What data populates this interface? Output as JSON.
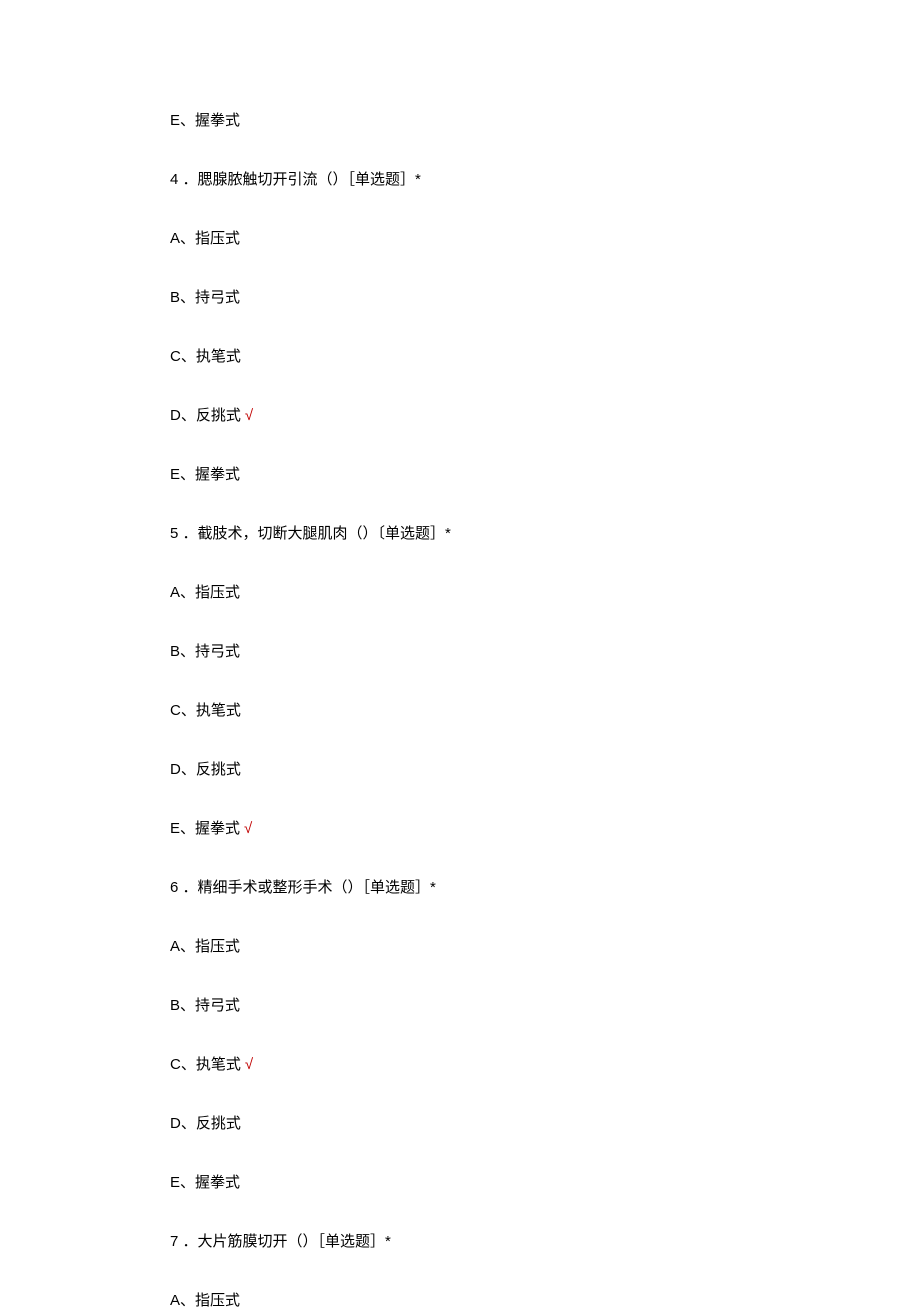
{
  "lines": [
    {
      "text": "E、握拳式",
      "check": false
    },
    {
      "text": "4 ．腮腺脓触切开引流（）［单选题］*",
      "check": false
    },
    {
      "text": "A、指压式",
      "check": false
    },
    {
      "text": "B、持弓式",
      "check": false
    },
    {
      "text": "C、执笔式",
      "check": false
    },
    {
      "text": "D、反挑式",
      "check": true
    },
    {
      "text": "E、握拳式",
      "check": false
    },
    {
      "text": "5 ．截肢术，切断大腿肌肉（）〔单选题］*",
      "check": false
    },
    {
      "text": "A、指压式",
      "check": false
    },
    {
      "text": "B、持弓式",
      "check": false
    },
    {
      "text": "C、执笔式",
      "check": false
    },
    {
      "text": "D、反挑式",
      "check": false
    },
    {
      "text": "E、握拳式",
      "check": true
    },
    {
      "text": "6 ．精细手术或整形手术（）［单选题］*",
      "check": false
    },
    {
      "text": "A、指压式",
      "check": false
    },
    {
      "text": "B、持弓式",
      "check": false
    },
    {
      "text": "C、执笔式",
      "check": true
    },
    {
      "text": "D、反挑式",
      "check": false
    },
    {
      "text": "E、握拳式",
      "check": false
    },
    {
      "text": "7 ．大片筋膜切开（）［单选题］*",
      "check": false
    },
    {
      "text": "A、指压式",
      "check": false
    }
  ],
  "checkmark": "√"
}
